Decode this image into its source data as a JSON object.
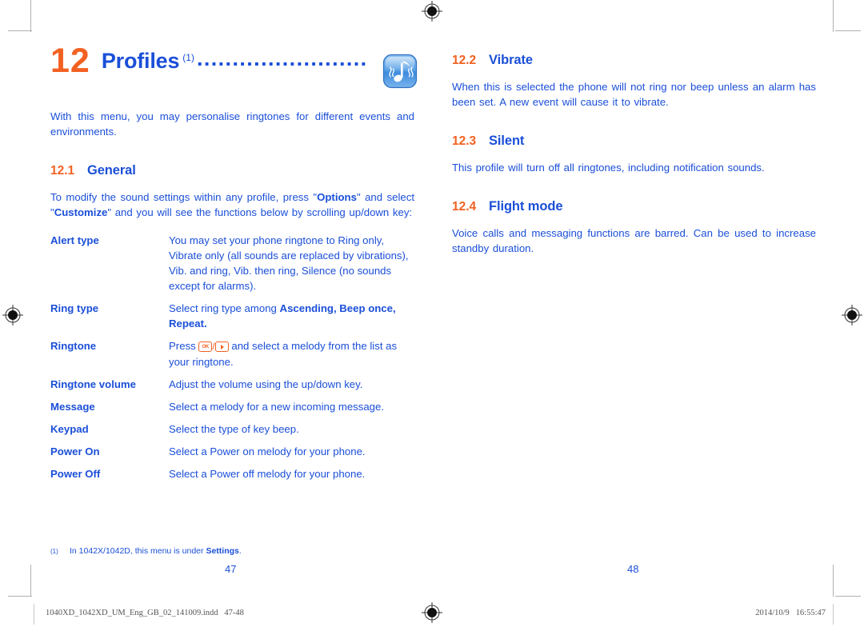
{
  "document": {
    "chapter": {
      "number": "12",
      "title": "Profiles",
      "footnote_ref": "(1)",
      "dots": "........................",
      "icon_name": "profiles-music-note-icon"
    },
    "intro": "With this menu, you may personalise ringtones for different events and environments."
  },
  "left_column": {
    "section_general": {
      "number": "12.1",
      "title": "General",
      "paragraph_1": "To modify the sound settings within any profile, press \"",
      "paragraph_bold_1": "Options",
      "paragraph_2": "\" and select \"",
      "paragraph_bold_2": "Customize",
      "paragraph_3": "\" and you will see the functions below by scrolling up/down key:"
    },
    "settings_table": [
      {
        "term": "Alert type",
        "description": "You may set your phone ringtone to Ring only, Vibrate only (all sounds are replaced by vibrations), Vib. and ring, Vib. then ring, Silence (no sounds except for alarms)."
      },
      {
        "term": "Ring type",
        "description_pre": "Select ring type among ",
        "description_bold": "Ascending, Beep once, Repeat.",
        "description_post": ""
      },
      {
        "term": "Ringtone",
        "description_pre": "Press ",
        "key_1": "OK",
        "key_separator": "/",
        "key_2": "right-arrow",
        "description_post": " and select a melody from the list as your ringtone."
      },
      {
        "term": "Ringtone volume",
        "description": "Adjust the volume using the up/down key."
      },
      {
        "term": "Message",
        "description": "Select a melody for a new incoming message."
      },
      {
        "term": "Keypad",
        "description": "Select the type of key beep."
      },
      {
        "term": "Power On",
        "description": "Select a Power on melody for your phone."
      },
      {
        "term": "Power Off",
        "description": "Select a Power off melody for your phone."
      }
    ],
    "footnote": {
      "mark": "(1)",
      "text_pre": "In 1042X/1042D, this menu is under ",
      "text_bold": "Settings",
      "text_post": "."
    },
    "page_number": "47"
  },
  "right_column": {
    "sections": [
      {
        "number": "12.2",
        "title": "Vibrate",
        "body": "When this is selected the phone will not ring nor beep unless an alarm has been set. A new event will cause it to vibrate."
      },
      {
        "number": "12.3",
        "title": "Silent",
        "body": "This profile will turn off all ringtones, including notification sounds."
      },
      {
        "number": "12.4",
        "title": "Flight mode",
        "body": "Voice calls and messaging functions are barred. Can be used to increase standby duration."
      }
    ],
    "page_number": "48"
  },
  "print_footer": {
    "filename": "1040XD_1042XD_UM_Eng_GB_02_141009.indd   47-48",
    "timestamp": "2014/10/9   16:55:47",
    "registration_mark_name": "registration-target-mark"
  },
  "colors": {
    "heading_orange": "#F26122",
    "text_blue": "#1B4FD8",
    "crop_mark_gray": "#b0b0b0",
    "footer_gray": "#555555"
  }
}
